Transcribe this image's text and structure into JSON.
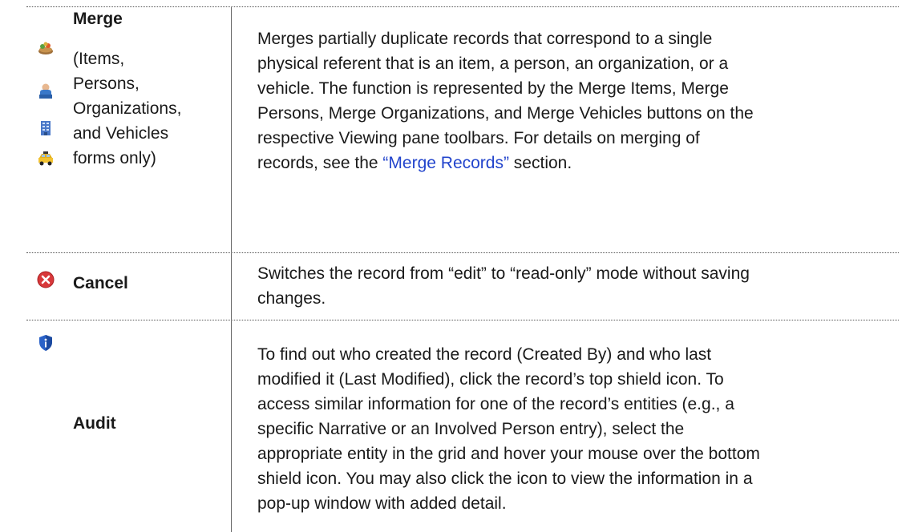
{
  "rows": [
    {
      "name": "Merge",
      "note_lines": [
        "(Items,",
        "Persons,",
        "Organizations,",
        "and Vehicles",
        "forms only)"
      ],
      "icons": [
        "merge-items-icon",
        "merge-persons-icon",
        "merge-organizations-icon",
        "merge-vehicles-icon"
      ],
      "description_lines": [
        "Merges partially duplicate records that correspond to a single",
        "physical referent that is an item, a person, an organization, or a",
        "vehicle. The function is represented by the Merge Items, Merge",
        "Persons, Merge Organizations, and Merge Vehicles buttons on the",
        "respective Viewing pane toolbars. For details on merging of"
      ],
      "description_last_prefix": "records, see the ",
      "description_link": "“Merge Records”",
      "description_last_suffix": " section."
    },
    {
      "name": "Cancel",
      "icons": [
        "cancel-icon"
      ],
      "description_lines": [
        "Switches the record from “edit” to “read-only” mode without saving",
        "changes."
      ]
    },
    {
      "name": "Audit",
      "icons": [
        "shield-icon"
      ],
      "description_lines": [
        "To find out who created the record (Created By) and who last",
        "modified it (Last Modified), click the record’s top shield icon. To",
        "access similar information for one of the record’s entities (e.g., a",
        "specific Narrative or an Involved Person entry), select the",
        "appropriate entity in the grid and hover your mouse over the bottom",
        "shield icon. You may also click the icon to view the information in a",
        "pop-up window with added detail."
      ]
    }
  ],
  "colors": {
    "link": "#2244cc",
    "text": "#1a1a1a"
  }
}
